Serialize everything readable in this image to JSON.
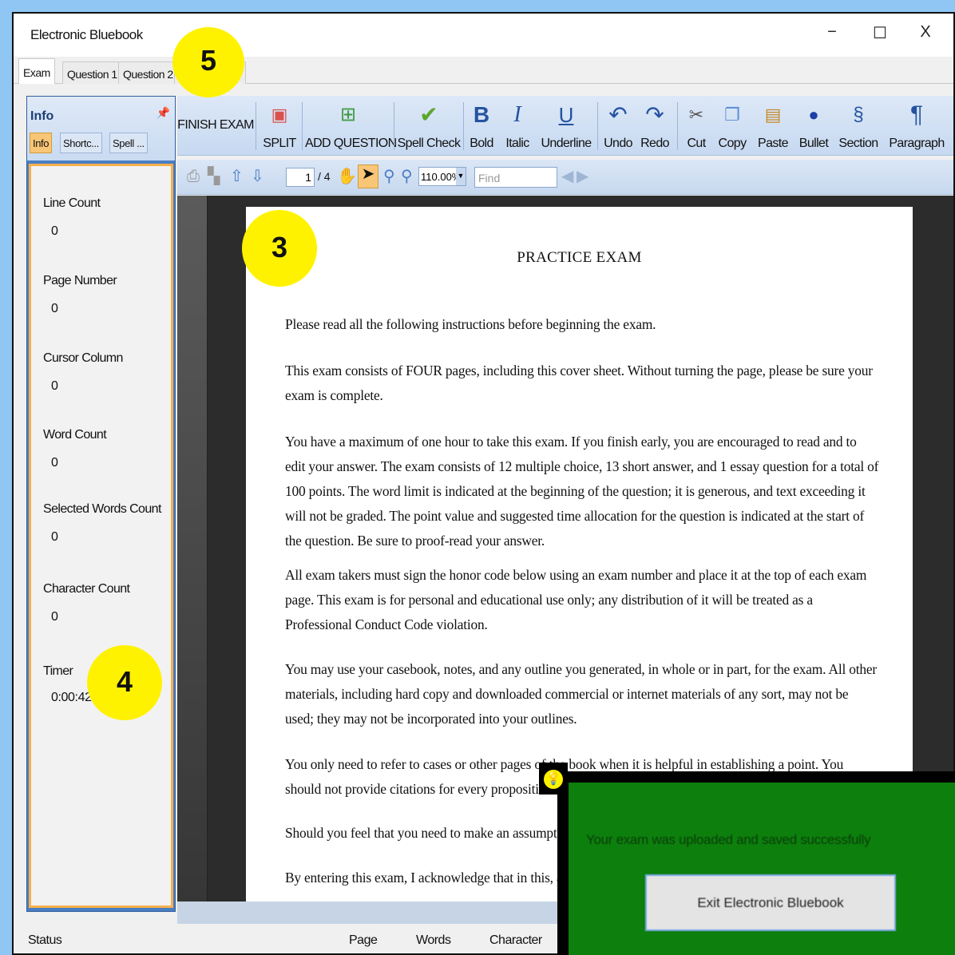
{
  "window": {
    "title": "Electronic Bluebook",
    "controls": {
      "minimize": "−",
      "maximize": "☐",
      "close": "X"
    }
  },
  "tabs": [
    "Exam",
    "Question 1",
    "Question 2",
    "e"
  ],
  "info_panel": {
    "title": "Info",
    "tabs": [
      "Info",
      "Shortc...",
      "Spell ..."
    ],
    "fields": [
      {
        "label": "Line Count",
        "value": "0"
      },
      {
        "label": "Page Number",
        "value": "0"
      },
      {
        "label": "Cursor Column",
        "value": "0"
      },
      {
        "label": "Word Count",
        "value": "0"
      },
      {
        "label": "Selected Words Count",
        "value": "0"
      },
      {
        "label": "Character Count",
        "value": "0"
      },
      {
        "label": "Timer",
        "value": "0:00:42"
      }
    ]
  },
  "ribbon": {
    "finish": "FINISH EXAM",
    "split": "SPLIT",
    "add_question": "ADD QUESTION",
    "spell_check": "Spell Check",
    "bold": "Bold",
    "italic": "Italic",
    "underline": "Underline",
    "undo": "Undo",
    "redo": "Redo",
    "cut": "Cut",
    "copy": "Copy",
    "paste": "Paste",
    "bullet": "Bullet",
    "section": "Section",
    "paragraph": "Paragraph"
  },
  "pdf_toolbar": {
    "page_current": "1",
    "page_total": "/ 4",
    "zoom": "110.00%",
    "find_placeholder": "Find"
  },
  "document": {
    "title": "PRACTICE EXAM",
    "paragraphs": [
      "Please read all the following instructions before beginning the exam.",
      "This exam consists of FOUR pages, including this cover sheet. Without turning the page, please be sure your exam is complete.",
      "You have a maximum of one hour to take this exam. If you finish early, you are encouraged to read and to edit your answer. The exam consists of 12 multiple choice, 13 short answer, and 1 essay question for a total of 100 points. The word limit is indicated at the beginning of the question; it is generous, and text exceeding it will not be graded. The point value and suggested time allocation for the question is indicated at the start of the question. Be sure to proof-read your answer.",
      "All exam takers must sign the honor code below using an exam number and place it at the top of each exam page. This exam is for personal and educational use only; any distribution of it will be treated as a Professional Conduct Code violation.",
      "You may use your casebook, notes, and any outline you generated, in whole or in part, for the exam. All other materials, including hard copy and downloaded commercial or internet materials of any sort, may not be used; they may not be incorporated into your outlines.",
      "You only need to refer to cases or other pages of the book when it is helpful in establishing a point. You should not provide citations for every proposition. You abbreviations, but please be sure to define them.",
      "Should you feel that you need to make an assumptio",
      "By entering this exam, I acknowledge that in this, as"
    ]
  },
  "status_bar": {
    "status": "Status",
    "page": "Page",
    "words": "Words",
    "character": "Character"
  },
  "callouts": [
    "5",
    "3",
    "4"
  ],
  "modal": {
    "message": "Your exam was uploaded and saved successfully",
    "exit_button": "Exit Electronic Bluebook"
  },
  "colors": {
    "background": "#8fc6f4",
    "callout": "#fff200",
    "modal": "#0d7f0d",
    "accent_tab": "#f8c676"
  }
}
